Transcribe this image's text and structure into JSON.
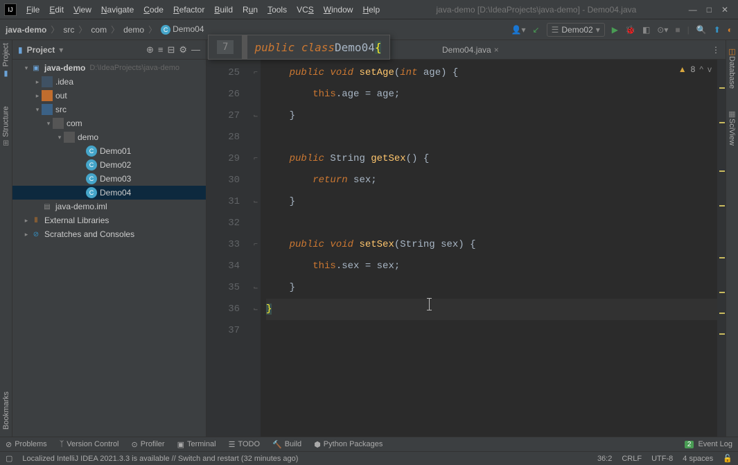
{
  "title": "java-demo [D:\\IdeaProjects\\java-demo] - Demo04.java",
  "menus": [
    "File",
    "Edit",
    "View",
    "Navigate",
    "Code",
    "Refactor",
    "Build",
    "Run",
    "Tools",
    "VCS",
    "Window",
    "Help"
  ],
  "breadcrumbs": {
    "root": "java-demo",
    "src": "src",
    "pkg1": "com",
    "pkg2": "demo",
    "cls": "Demo04"
  },
  "run_config": "Demo02",
  "project_panel_title": "Project",
  "tree": {
    "root": "java-demo",
    "root_hint": "D:\\IdeaProjects\\java-demo",
    "idea": ".idea",
    "out": "out",
    "src": "src",
    "com": "com",
    "demo": "demo",
    "d1": "Demo01",
    "d2": "Demo02",
    "d3": "Demo03",
    "d4": "Demo04",
    "iml": "java-demo.iml",
    "ext": "External Libraries",
    "scratch": "Scratches and Consoles"
  },
  "tab_name": "Demo04.java",
  "floating": {
    "ln": "7",
    "code_pre": "public class ",
    "cls": "Demo04",
    "brace": " {"
  },
  "lines": [
    "25",
    "26",
    "27",
    "28",
    "29",
    "30",
    "31",
    "32",
    "33",
    "34",
    "35",
    "36",
    "37"
  ],
  "code": {
    "l25_pub": "public",
    "l25_void": " void ",
    "l25_m": "setAge",
    "l25_p": "(",
    "l25_int": "int",
    "l25_rest": " age) {",
    "l26_this": "this",
    "l26_rest": ".age = age;",
    "l27": "}",
    "l29_pub": "public",
    "l29_str": " String ",
    "l29_m": "getSex",
    "l29_rest": "() {",
    "l30_ret": "return",
    "l30_rest": " sex;",
    "l31": "}",
    "l33_pub": "public",
    "l33_void": " void ",
    "l33_m": "setSex",
    "l33_p": "(String sex) {",
    "l34_this": "this",
    "l34_rest": ".sex = sex;",
    "l35": "}",
    "l36": "}"
  },
  "warnings_count": "8",
  "bottom": {
    "problems": "Problems",
    "vcs": "Version Control",
    "profiler": "Profiler",
    "terminal": "Terminal",
    "todo": "TODO",
    "build": "Build",
    "py": "Python Packages",
    "eventlog": "Event Log",
    "evt_badge": "2"
  },
  "status": {
    "msg": "Localized IntelliJ IDEA 2021.3.3 is available // Switch and restart (32 minutes ago)",
    "pos": "36:2",
    "sep": "CRLF",
    "enc": "UTF-8",
    "indent": "4 spaces"
  },
  "side": {
    "project": "Project",
    "structure": "Structure",
    "bookmarks": "Bookmarks",
    "database": "Database",
    "sciview": "SciView"
  }
}
